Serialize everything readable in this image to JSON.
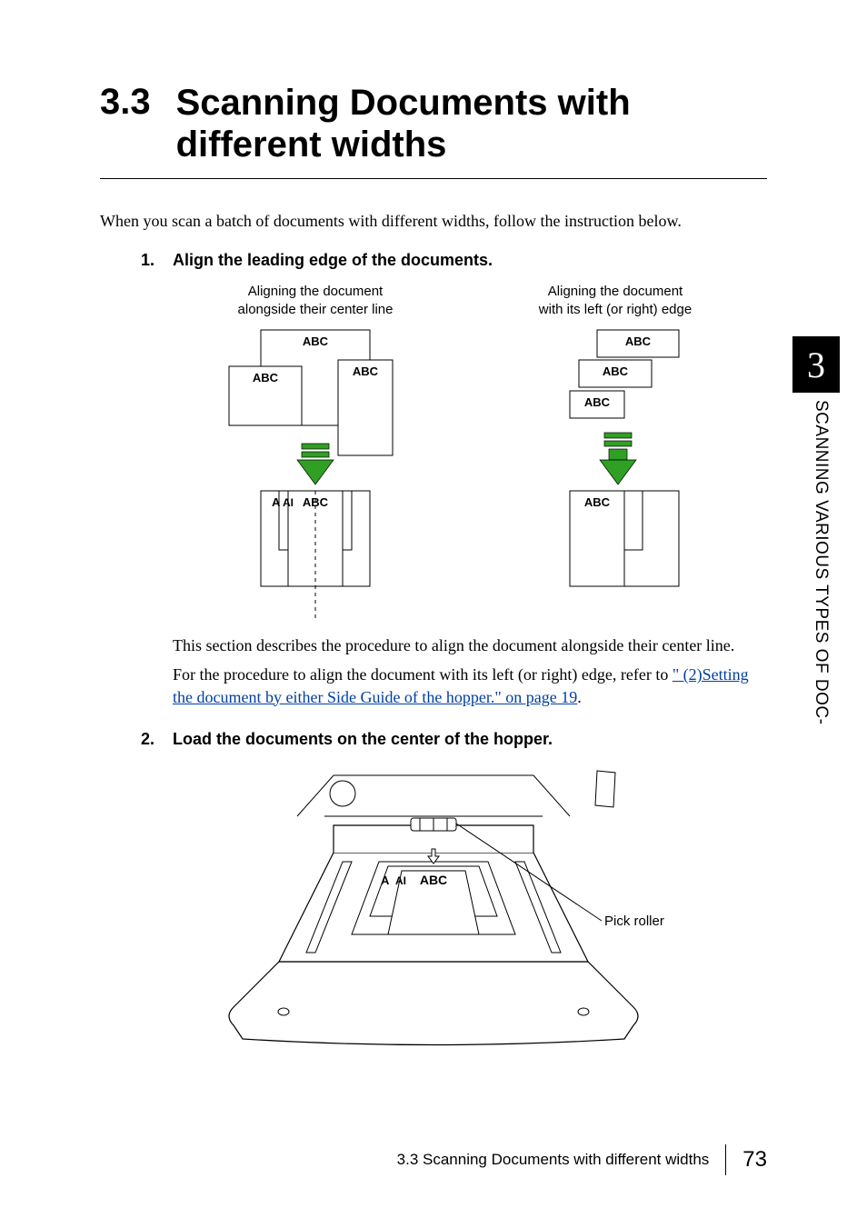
{
  "heading": {
    "number": "3.3",
    "title": "Scanning Documents with different widths"
  },
  "intro": "When you scan a batch of documents with different widths, follow the instruction below.",
  "steps": [
    {
      "num": "1.",
      "text": "Align the leading edge of the documents."
    },
    {
      "num": "2.",
      "text": "Load the documents on the center of the hopper."
    }
  ],
  "diagramCaptions": {
    "center": {
      "l1": "Aligning the document",
      "l2": "alongside their center line"
    },
    "edge": {
      "l1": "Aligning the document",
      "l2": "with its left (or right) edge"
    }
  },
  "docLabels": {
    "abc": "ABC",
    "a": "A",
    "ai": "AI"
  },
  "scanner": {
    "pickRoller": "Pick roller"
  },
  "paragraph": {
    "p1": "This section describes the procedure to align the document alongside their center line.",
    "p2a": "For the procedure to align the document with its left (or right) edge, refer to ",
    "link": "\" (2)Setting the document by either Side Guide of the hopper.\" on page 19",
    "p2b": "."
  },
  "sideTab": {
    "chapter": "3",
    "label": "SCANNING VARIOUS TYPES OF DOC-"
  },
  "footer": {
    "section": "3.3 Scanning Documents with different widths",
    "page": "73"
  }
}
